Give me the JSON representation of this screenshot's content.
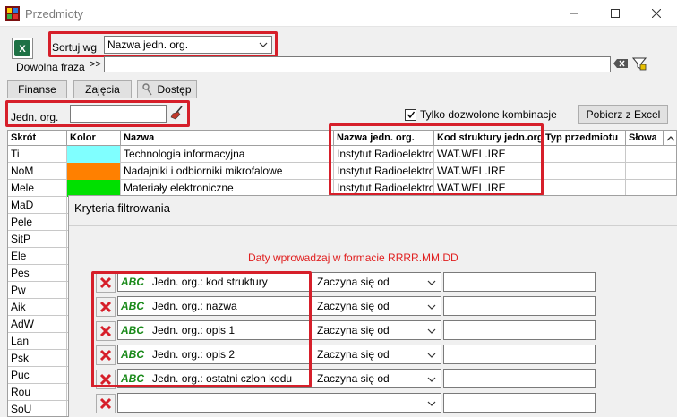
{
  "window": {
    "title": "Przedmioty"
  },
  "toolbar": {
    "sort_label": "Sortuj wg",
    "sort_value": "Nazwa jedn. org.",
    "phrase_label": "Dowolna fraza",
    "phrase_prefix": ">>",
    "phrase_value": ""
  },
  "buttons": {
    "finanse": "Finanse",
    "zajecia": "Zajęcia",
    "dostep": "Dostęp",
    "export": "Pobierz z Excel"
  },
  "org_filter": {
    "label": "Jedn. org.",
    "value": "",
    "allowed_label": "Tylko dozwolone kombinacje",
    "allowed_checked": true
  },
  "grid": {
    "columns": [
      "Skrót",
      "Kolor",
      "Nazwa",
      "Nazwa jedn. org.",
      "Kod struktury jedn.org.",
      "Typ przedmiotu",
      "Słowa"
    ],
    "rows": [
      {
        "code": "Ti",
        "color": "#80ffff",
        "name": "Technologia informacyjna",
        "org": "Instytut Radioelektro",
        "struct": "WAT.WEL.IRE"
      },
      {
        "code": "NoM",
        "color": "#ff8000",
        "name": "Nadajniki i odbiorniki mikrofalowe",
        "org": "Instytut Radioelektro",
        "struct": "WAT.WEL.IRE"
      },
      {
        "code": "Mele",
        "color": "#00e000",
        "name": "Materiały elektroniczne",
        "org": "Instytut Radioelektro",
        "struct": "WAT.WEL.IRE"
      },
      {
        "code": "MaD",
        "color": "",
        "name": "",
        "org": "",
        "struct": ""
      },
      {
        "code": "Pele",
        "color": "",
        "name": "",
        "org": "",
        "struct": ""
      },
      {
        "code": "SitP",
        "color": "",
        "name": "",
        "org": "",
        "struct": ""
      },
      {
        "code": "Ele",
        "color": "",
        "name": "",
        "org": "",
        "struct": ""
      },
      {
        "code": "Pes",
        "color": "",
        "name": "",
        "org": "",
        "struct": ""
      },
      {
        "code": "Pw",
        "color": "",
        "name": "",
        "org": "",
        "struct": ""
      },
      {
        "code": "Aik",
        "color": "",
        "name": "",
        "org": "",
        "struct": ""
      },
      {
        "code": "AdW",
        "color": "",
        "name": "",
        "org": "",
        "struct": ""
      },
      {
        "code": "Lan",
        "color": "",
        "name": "",
        "org": "",
        "struct": ""
      },
      {
        "code": "Psk",
        "color": "",
        "name": "",
        "org": "",
        "struct": ""
      },
      {
        "code": "Puc",
        "color": "",
        "name": "",
        "org": "",
        "struct": ""
      },
      {
        "code": "Rou",
        "color": "",
        "name": "",
        "org": "",
        "struct": ""
      },
      {
        "code": "SoU",
        "color": "",
        "name": "",
        "org": "",
        "struct": ""
      }
    ]
  },
  "filter_panel": {
    "title": "Kryteria filtrowania",
    "hint": "Daty wprowadzaj w formacie RRRR.MM.DD",
    "type_tag": "ABC",
    "criteria": [
      {
        "field": "Jedn. org.: kod struktury",
        "op": "Zaczyna się od",
        "value": ""
      },
      {
        "field": "Jedn. org.: nazwa",
        "op": "Zaczyna się od",
        "value": ""
      },
      {
        "field": "Jedn. org.: opis 1",
        "op": "Zaczyna się od",
        "value": ""
      },
      {
        "field": "Jedn. org.: opis 2",
        "op": "Zaczyna się od",
        "value": ""
      },
      {
        "field": "Jedn. org.: ostatni człon kodu",
        "op": "Zaczyna się od",
        "value": ""
      },
      {
        "field": "",
        "op": "",
        "value": ""
      }
    ]
  },
  "colors": {
    "highlight": "#d61f2a",
    "type_tag": "#1a8a1a",
    "hint": "#e02020"
  }
}
